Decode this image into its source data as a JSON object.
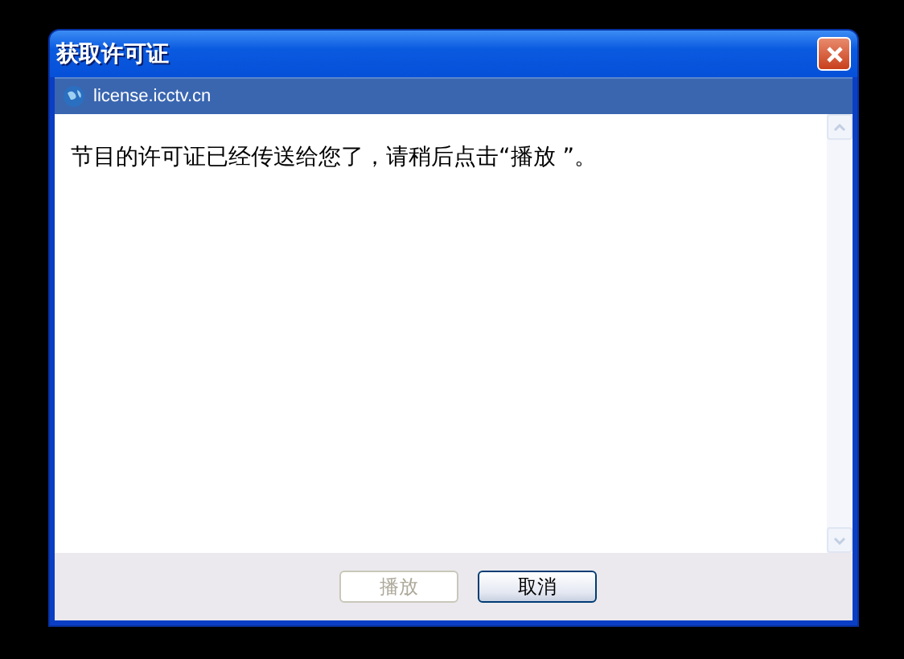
{
  "window": {
    "title": "获取许可证"
  },
  "address_bar": {
    "url": "license.icctv.cn"
  },
  "content": {
    "message": "节目的许可证已经传送给您了，请稍后点击“播放 ”。"
  },
  "buttons": [
    {
      "label": "播放",
      "disabled": true
    },
    {
      "label": "取消",
      "disabled": false
    }
  ]
}
